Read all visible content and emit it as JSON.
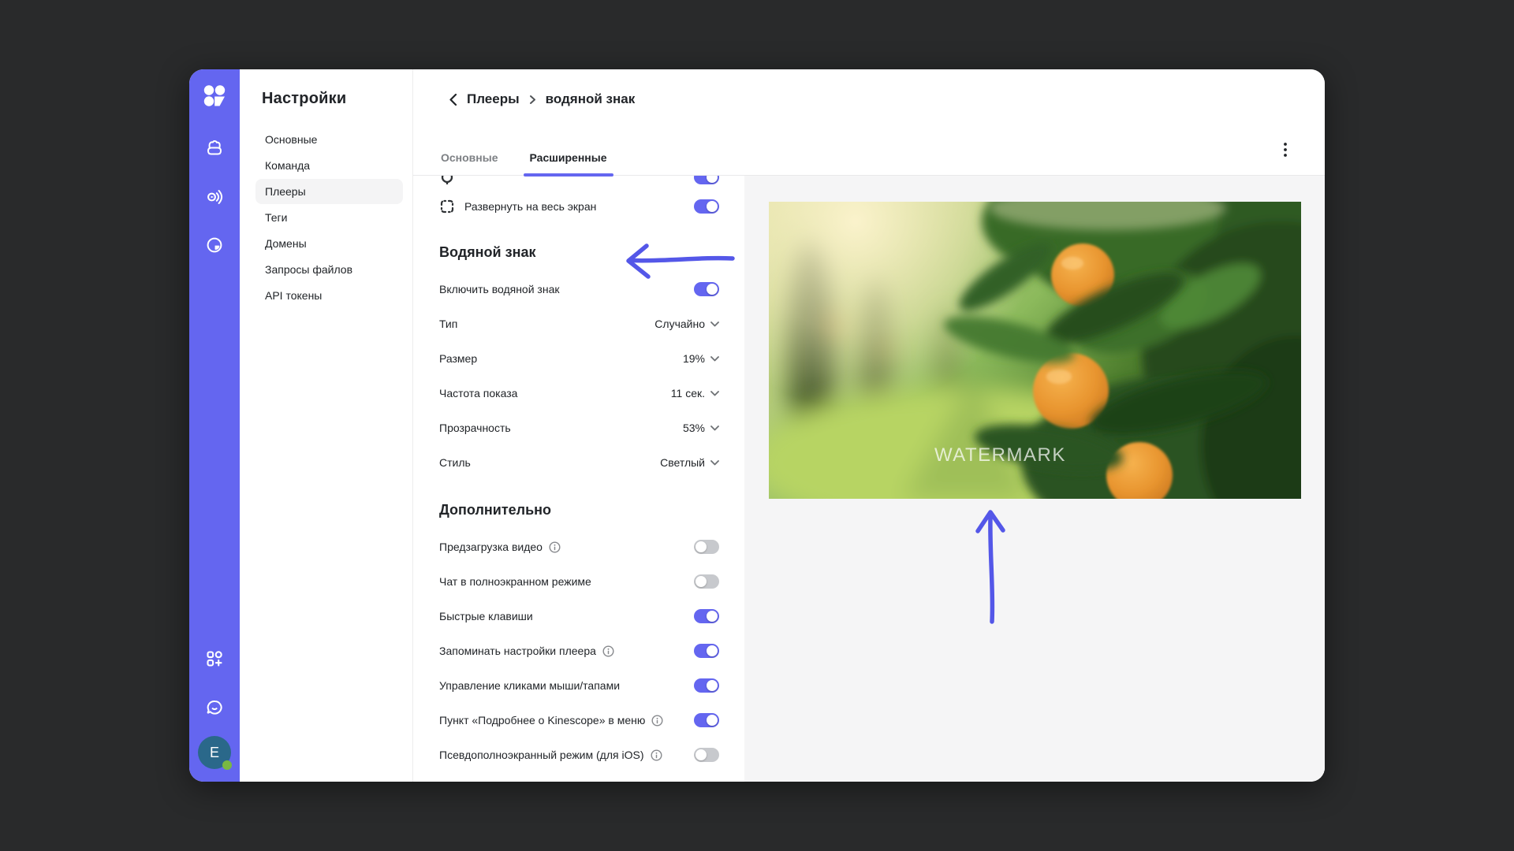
{
  "app": {
    "accent_color": "#6466f0",
    "arrow_color": "#5457e8",
    "background_color": "#292a2b",
    "preview_background": "#f5f5f6"
  },
  "sidebar": {
    "logo_icon": "kinescope-logo",
    "top_icons": [
      {
        "name": "projects-folder-icon"
      },
      {
        "name": "player-icon"
      },
      {
        "name": "analytics-icon"
      }
    ],
    "bottom_icons": [
      {
        "name": "apps-plus-icon"
      },
      {
        "name": "chat-icon"
      }
    ],
    "avatar": {
      "initial": "E",
      "status_color": "#79b843"
    }
  },
  "settings_nav": {
    "title": "Настройки",
    "items": [
      {
        "label": "Основные",
        "active": false
      },
      {
        "label": "Команда",
        "active": false
      },
      {
        "label": "Плееры",
        "active": true
      },
      {
        "label": "Теги",
        "active": false
      },
      {
        "label": "Домены",
        "active": false
      },
      {
        "label": "Запросы файлов",
        "active": false
      },
      {
        "label": "API токены",
        "active": false
      }
    ]
  },
  "header": {
    "back_icon": "chevron-left-icon",
    "breadcrumb": [
      "Плееры",
      "водяной знак"
    ],
    "tabs": [
      {
        "label": "Основные",
        "active": false
      },
      {
        "label": "Расширенные",
        "active": true
      }
    ],
    "menu_icon": "kebab-menu-icon"
  },
  "settings_panel": {
    "partial_row": {
      "toggle": true
    },
    "fullscreen_row": {
      "label": "Развернуть на весь экран",
      "toggle": true
    },
    "watermark_section": {
      "title": "Водяной знак",
      "enable_row": {
        "label": "Включить водяной знак",
        "toggle": true
      },
      "rows": [
        {
          "label": "Тип",
          "value": "Случайно"
        },
        {
          "label": "Размер",
          "value": "19%"
        },
        {
          "label": "Частота показа",
          "value": "11 сек."
        },
        {
          "label": "Прозрачность",
          "value": "53%"
        },
        {
          "label": "Стиль",
          "value": "Светлый"
        }
      ]
    },
    "additional_section": {
      "title": "Дополнительно",
      "rows": [
        {
          "label": "Предзагрузка видео",
          "info": true,
          "toggle": false
        },
        {
          "label": "Чат в полноэкранном режиме",
          "info": false,
          "toggle": false
        },
        {
          "label": "Быстрые клавиши",
          "info": false,
          "toggle": true
        },
        {
          "label": "Запоминать настройки плеера",
          "info": true,
          "toggle": true
        },
        {
          "label": "Управление кликами мыши/тапами",
          "info": false,
          "toggle": true
        },
        {
          "label": "Пункт «Подробнее о Kinescope» в меню",
          "info": true,
          "toggle": true
        },
        {
          "label": "Псевдополноэкранный режим (для iOS)",
          "info": true,
          "toggle": false
        }
      ]
    }
  },
  "preview": {
    "watermark_text": "WATERMARK",
    "annotations": [
      "arrow-left-to-watermark-heading",
      "arrow-up-to-video-watermark"
    ]
  }
}
